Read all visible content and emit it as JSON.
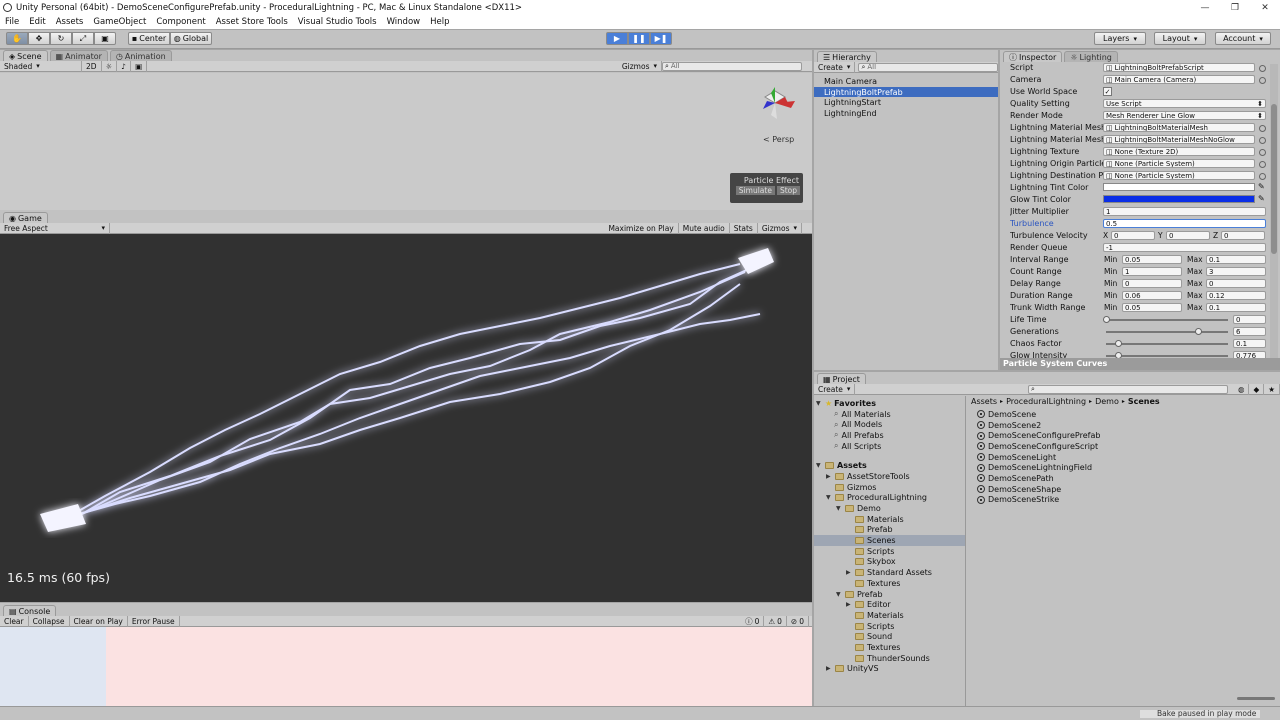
{
  "window": {
    "title": "Unity Personal (64bit) - DemoSceneConfigurePrefab.unity - ProceduralLightning - PC, Mac & Linux Standalone <DX11>"
  },
  "menu": [
    "File",
    "Edit",
    "Assets",
    "GameObject",
    "Component",
    "Asset Store Tools",
    "Visual Studio Tools",
    "Window",
    "Help"
  ],
  "toolbar": {
    "center": "Center",
    "global": "Global",
    "layers": "Layers",
    "layout": "Layout",
    "account": "Account"
  },
  "scene": {
    "tabs": [
      "Scene",
      "Animator",
      "Animation"
    ],
    "shading": "Shaded",
    "mode2d": "2D",
    "gizmos": "Gizmos",
    "search": "All",
    "persp": "Persp",
    "particle_effect": "Particle Effect",
    "simulate": "Simulate",
    "stop": "Stop"
  },
  "game": {
    "tab": "Game",
    "aspect": "Free Aspect",
    "maximize": "Maximize on Play",
    "mute": "Mute audio",
    "stats": "Stats",
    "gizmos": "Gizmos",
    "fps": "16.5 ms (60 fps)"
  },
  "console": {
    "tab": "Console",
    "buttons": [
      "Clear",
      "Collapse",
      "Clear on Play",
      "Error Pause"
    ],
    "counts": [
      "0",
      "0",
      "0"
    ]
  },
  "hierarchy": {
    "tab": "Hierarchy",
    "create": "Create",
    "search": "All",
    "items": [
      "Main Camera",
      "LightningBoltPrefab",
      "LightningStart",
      "LightningEnd"
    ],
    "selected": 1
  },
  "inspector": {
    "tab": "Inspector",
    "tab2": "Lighting",
    "rows": [
      {
        "label": "Script",
        "type": "obj",
        "value": "LightningBoltPrefabScript"
      },
      {
        "label": "Camera",
        "type": "obj",
        "value": "Main Camera (Camera)"
      },
      {
        "label": "Use World Space",
        "type": "check",
        "value": "✓"
      },
      {
        "label": "Quality Setting",
        "type": "enum",
        "value": "Use Script"
      },
      {
        "label": "Render Mode",
        "type": "enum",
        "value": "Mesh Renderer Line Glow"
      },
      {
        "label": "Lightning Material Mesh",
        "type": "obj",
        "value": "LightningBoltMaterialMesh"
      },
      {
        "label": "Lightning Material Mesh N",
        "type": "obj",
        "value": "LightningBoltMaterialMeshNoGlow"
      },
      {
        "label": "Lightning Texture",
        "type": "obj",
        "value": "None (Texture 2D)"
      },
      {
        "label": "Lightning Origin Particle",
        "type": "obj",
        "value": "None (Particle System)"
      },
      {
        "label": "Lightning Destination Pa",
        "type": "obj",
        "value": "None (Particle System)"
      },
      {
        "label": "Lightning Tint Color",
        "type": "color",
        "value": "#ffffff"
      },
      {
        "label": "Glow Tint Color",
        "type": "color",
        "value": "#0a2ee6"
      },
      {
        "label": "Jitter Multiplier",
        "type": "text",
        "value": "1"
      },
      {
        "label": "Turbulence",
        "type": "text",
        "value": "0.5",
        "active": true
      },
      {
        "label": "Turbulence Velocity",
        "type": "xyz",
        "x": "0",
        "y": "0",
        "z": "0"
      },
      {
        "label": "Render Queue",
        "type": "text",
        "value": "-1"
      },
      {
        "label": "Interval Range",
        "type": "minmax",
        "min": "0.05",
        "max": "0.1"
      },
      {
        "label": "Count Range",
        "type": "minmax",
        "min": "1",
        "max": "3"
      },
      {
        "label": "Delay Range",
        "type": "minmax",
        "min": "0",
        "max": "0"
      },
      {
        "label": "Duration Range",
        "type": "minmax",
        "min": "0.06",
        "max": "0.12"
      },
      {
        "label": "Trunk Width Range",
        "type": "minmax",
        "min": "0.05",
        "max": "0.1"
      },
      {
        "label": "Life Time",
        "type": "slider",
        "value": "0",
        "level": 0
      },
      {
        "label": "Generations",
        "type": "slider",
        "value": "6",
        "level": 0.75
      },
      {
        "label": "Chaos Factor",
        "type": "slider",
        "value": "0.1",
        "level": 0.1
      },
      {
        "label": "Glow Intensity",
        "type": "slider",
        "value": "0.776",
        "level": 0.1
      }
    ],
    "xyz_labels": [
      "X",
      "Y",
      "Z"
    ],
    "min_label": "Min",
    "max_label": "Max",
    "curves": "Particle System Curves"
  },
  "project": {
    "tab": "Project",
    "create": "Create",
    "favorites_title": "Favorites",
    "favorites": [
      "All Materials",
      "All Models",
      "All Prefabs",
      "All Scripts"
    ],
    "assets_title": "Assets",
    "tree": [
      {
        "name": "AssetStoreTools",
        "depth": 1,
        "arrow": "▶"
      },
      {
        "name": "Gizmos",
        "depth": 1,
        "arrow": ""
      },
      {
        "name": "ProceduralLightning",
        "depth": 1,
        "arrow": "▼"
      },
      {
        "name": "Demo",
        "depth": 2,
        "arrow": "▼"
      },
      {
        "name": "Materials",
        "depth": 3,
        "arrow": ""
      },
      {
        "name": "Prefab",
        "depth": 3,
        "arrow": ""
      },
      {
        "name": "Scenes",
        "depth": 3,
        "arrow": "",
        "selected": true
      },
      {
        "name": "Scripts",
        "depth": 3,
        "arrow": ""
      },
      {
        "name": "Skybox",
        "depth": 3,
        "arrow": ""
      },
      {
        "name": "Standard Assets",
        "depth": 3,
        "arrow": "▶"
      },
      {
        "name": "Textures",
        "depth": 3,
        "arrow": ""
      },
      {
        "name": "Prefab",
        "depth": 2,
        "arrow": "▼"
      },
      {
        "name": "Editor",
        "depth": 3,
        "arrow": "▶"
      },
      {
        "name": "Materials",
        "depth": 3,
        "arrow": ""
      },
      {
        "name": "Scripts",
        "depth": 3,
        "arrow": ""
      },
      {
        "name": "Sound",
        "depth": 3,
        "arrow": ""
      },
      {
        "name": "Textures",
        "depth": 3,
        "arrow": ""
      },
      {
        "name": "ThunderSounds",
        "depth": 3,
        "arrow": ""
      },
      {
        "name": "UnityVS",
        "depth": 1,
        "arrow": "▶"
      }
    ],
    "breadcrumb": [
      "Assets",
      "ProceduralLightning",
      "Demo",
      "Scenes"
    ],
    "files": [
      "DemoScene",
      "DemoScene2",
      "DemoSceneConfigurePrefab",
      "DemoSceneConfigureScript",
      "DemoSceneLight",
      "DemoSceneLightningField",
      "DemoScenePath",
      "DemoSceneShape",
      "DemoSceneStrike"
    ]
  },
  "status": {
    "text": "Bake paused in play mode"
  },
  "colors": {
    "play_active": "#4a7fd8",
    "selection": "#3d6cc0",
    "glow": "#0a2ee6"
  }
}
